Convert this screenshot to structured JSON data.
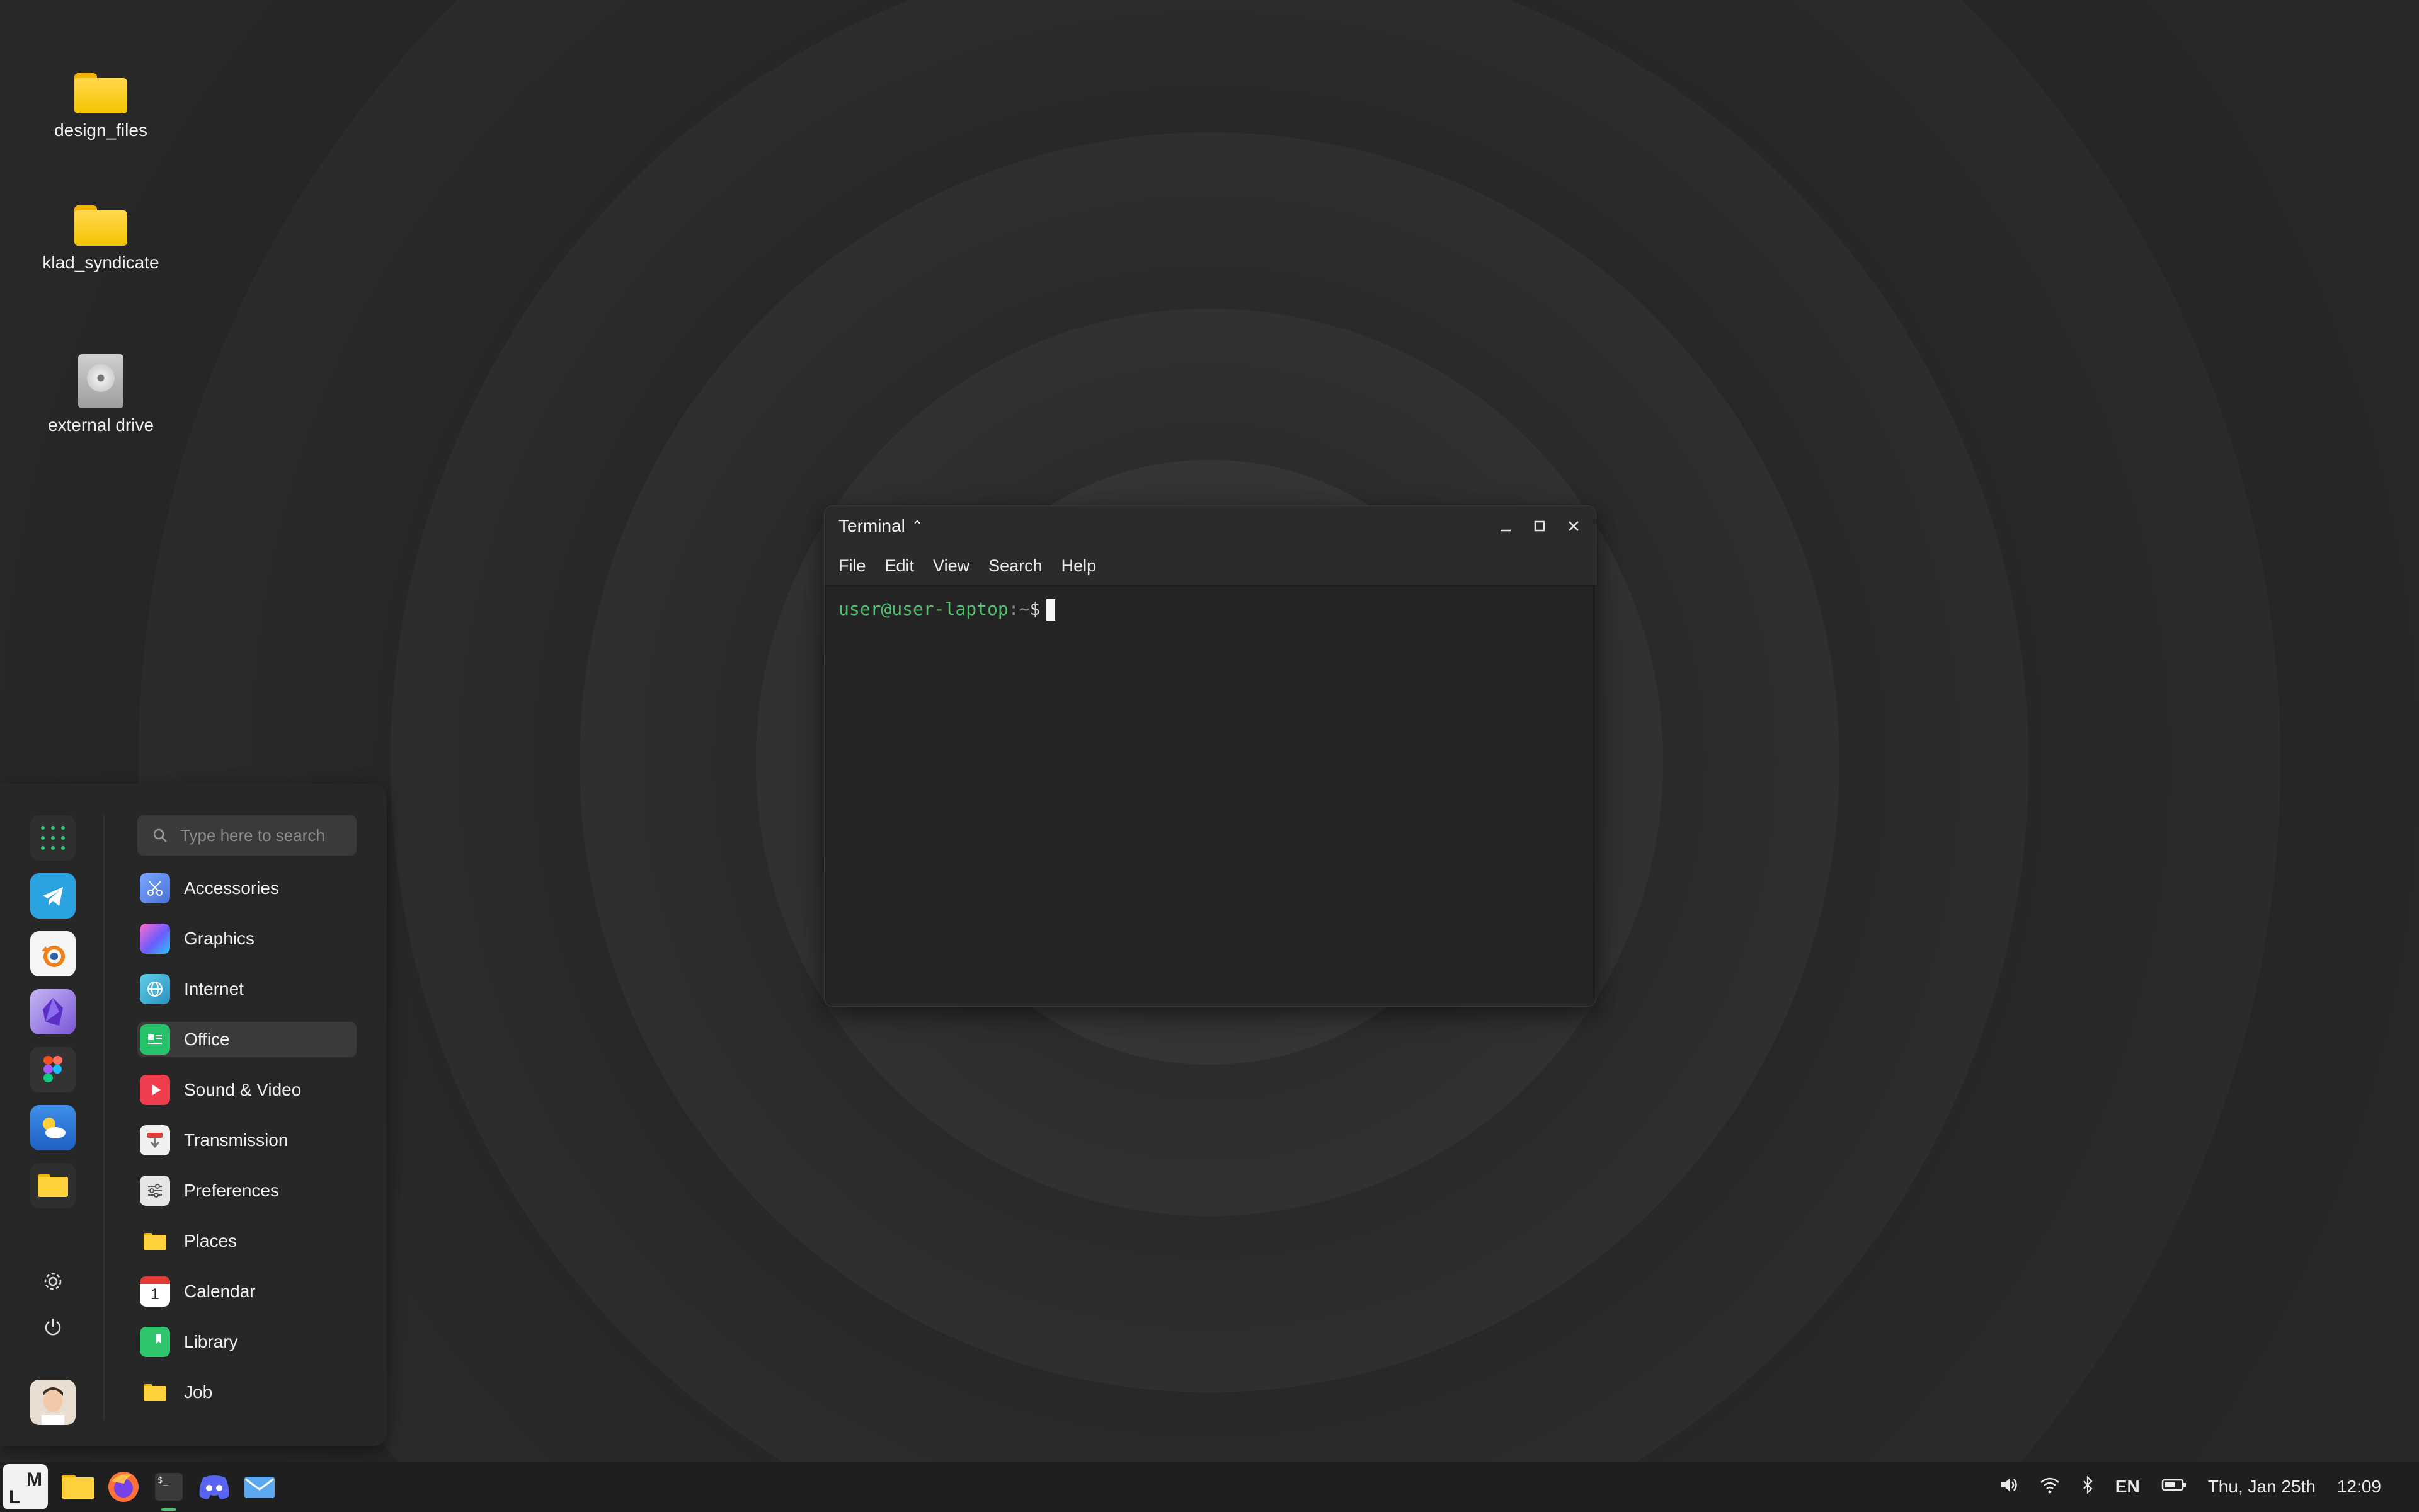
{
  "desktop": {
    "icons": [
      {
        "label": "design_files",
        "type": "folder"
      },
      {
        "label": "klad_syndicate",
        "type": "folder"
      },
      {
        "label": "external drive",
        "type": "drive"
      }
    ]
  },
  "terminal": {
    "title": "Terminal",
    "menu": [
      "File",
      "Edit",
      "View",
      "Search",
      "Help"
    ],
    "prompt_user": "user@user-laptop",
    "prompt_path": ":~",
    "prompt_symbol": "$"
  },
  "start_menu": {
    "search_placeholder": "Type here to search",
    "favorites": [
      "telegram",
      "blender",
      "obsidian",
      "figma",
      "weather",
      "files"
    ],
    "categories": [
      {
        "label": "Accessories",
        "icon": "scissors-icon",
        "color": "#5b86e5"
      },
      {
        "label": "Graphics",
        "icon": "gradient-icon",
        "color": "#8b5cf6"
      },
      {
        "label": "Internet",
        "icon": "globe-icon",
        "color": "#2aa6c9"
      },
      {
        "label": "Office",
        "icon": "document-icon",
        "color": "#27c16a"
      },
      {
        "label": "Sound & Video",
        "icon": "play-icon",
        "color": "#f03d4e"
      },
      {
        "label": "Transmission",
        "icon": "download-icon",
        "color": "#e8e8e8"
      },
      {
        "label": "Preferences",
        "icon": "sliders-icon",
        "color": "#e6e6e6"
      },
      {
        "label": "Places",
        "icon": "folder-icon",
        "color": "#f5c400"
      },
      {
        "label": "Calendar",
        "icon": "calendar-icon",
        "color": "#ffffff"
      },
      {
        "label": "Library",
        "icon": "bookmark-icon",
        "color": "#2fc46b"
      },
      {
        "label": "Job",
        "icon": "folder-icon",
        "color": "#f5c400"
      }
    ],
    "active_category": "Office",
    "calendar_day": "1"
  },
  "taskbar": {
    "apps": [
      "files",
      "firefox",
      "terminal",
      "discord",
      "mail"
    ],
    "active_app": "terminal",
    "tray": {
      "language": "EN",
      "date": "Thu, Jan 25th",
      "time": "12:09"
    }
  },
  "colors": {
    "accent": "#4fbf6b",
    "panel": "#272727",
    "taskbar": "#1f1f1f"
  }
}
